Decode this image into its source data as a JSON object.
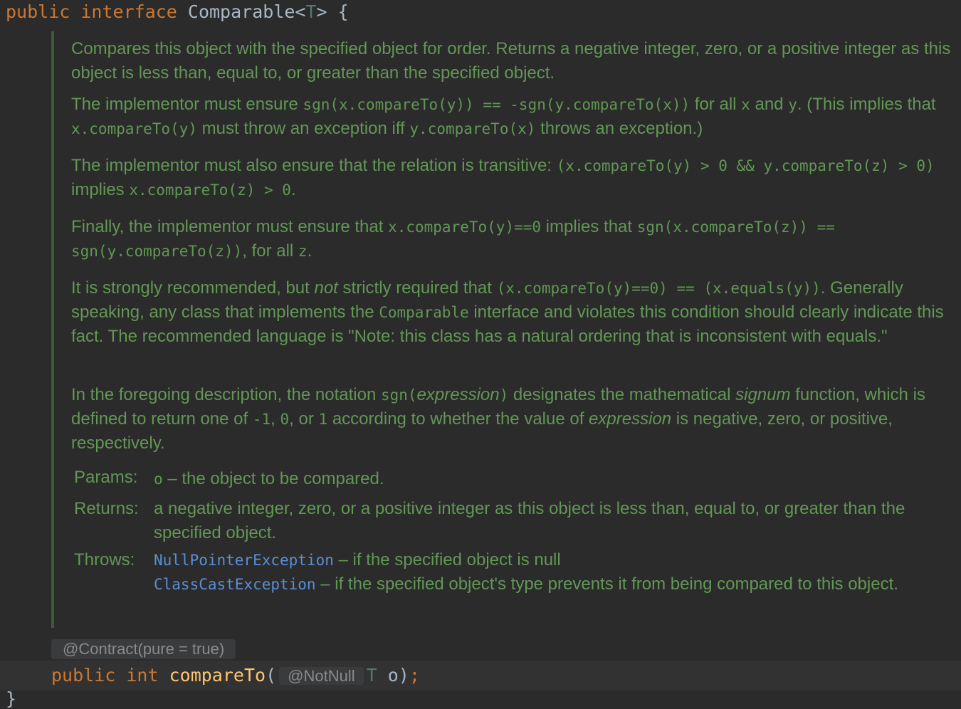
{
  "header": {
    "kw_public": "public",
    "kw_interface": "interface",
    "class_name": "Comparable",
    "lt": "<",
    "type_param": "T",
    "gt": ">",
    "brace": "{"
  },
  "doc": {
    "p1": "Compares this object with the specified object for order. Returns a negative integer, zero, or a positive integer as this object is less than, equal to, or greater than the specified object.",
    "p2": {
      "a": "The implementor must ensure ",
      "c1": "sgn(x.compareTo(y)) == -sgn(y.compareTo(x))",
      "b": " for all ",
      "c2": "x",
      "c": " and ",
      "c3": "y",
      "d": ". (This implies that ",
      "c4": "x.compareTo(y)",
      "e": " must throw an exception iff ",
      "c5": "y.compareTo(x)",
      "f": " throws an exception.)"
    },
    "p3": {
      "a": "The implementor must also ensure that the relation is transitive: ",
      "c1": "(x.compareTo(y) > 0 && y.compareTo(z) > 0)",
      "b": " implies ",
      "c2": "x.compareTo(z) > 0",
      "c": "."
    },
    "p4": {
      "a": "Finally, the implementor must ensure that ",
      "c1": "x.compareTo(y)==0",
      "b": " implies that ",
      "c2": "sgn(x.compareTo(z)) == sgn(y.compareTo(z))",
      "c": ", for all ",
      "c3": "z",
      "d": "."
    },
    "p5": {
      "a": "It is strongly recommended, but ",
      "em": "not",
      "b": " strictly required that ",
      "c1": "(x.compareTo(y)==0) == (x.equals(y))",
      "c": ". Generally speaking, any class that implements the ",
      "c2": "Comparable",
      "d": " interface and violates this condition should clearly indicate this fact. The recommended language is \"Note: this class has a natural ordering that is inconsistent with equals.\""
    },
    "p6": {
      "a": "In the foregoing description, the notation ",
      "c1": "sgn(",
      "em1": "expression",
      "c2": ")",
      "b": " designates the mathematical ",
      "em2": "signum",
      "c": " function, which is defined to return one of ",
      "c3": "-1",
      "d": ", ",
      "c4": "0",
      "e": ", or ",
      "c5": "1",
      "f": " according to whether the value of ",
      "em3": "expression",
      "g": " is negative, zero, or positive, respectively."
    },
    "params": {
      "label": "Params:",
      "name": "o",
      "desc": " – the object to be compared."
    },
    "returns": {
      "label": "Returns:",
      "desc": "a negative integer, zero, or a positive integer as this object is less than, equal to, or greater than the specified object."
    },
    "throws": {
      "label": "Throws:",
      "ex1": "NullPointerException",
      "desc1": " – if the specified object is null",
      "ex2": "ClassCastException",
      "desc2": " – if the specified object's type prevents it from being compared to this object."
    }
  },
  "annotation": "@Contract(pure = true)",
  "signature": {
    "kw_public": "public",
    "kw_int": "int",
    "method": "compareTo",
    "open": "(",
    "inlay": "@NotNull",
    "type": "T",
    "param": "o",
    "close": ")",
    "semi": ";"
  },
  "closing_brace": "}",
  "colors": {
    "background": "#2b2b2b",
    "doc_text": "#629755",
    "keyword": "#cc7832",
    "method": "#ffc66d",
    "link": "#5a8fd4"
  }
}
